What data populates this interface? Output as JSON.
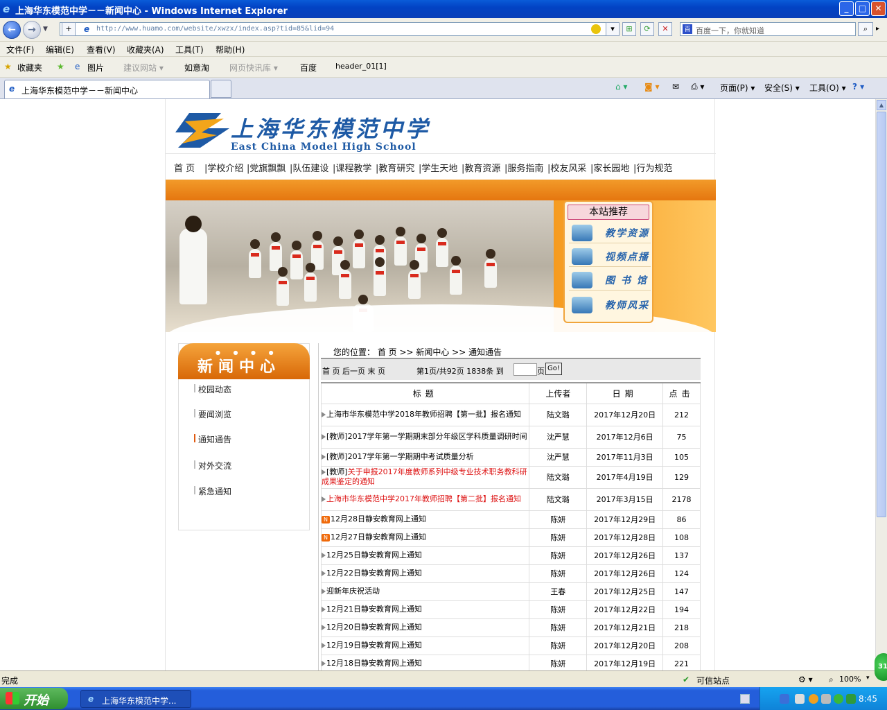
{
  "window": {
    "title": "上海华东模范中学－－新闻中心 - Windows Internet Explorer",
    "minimize": "_",
    "maximize": "□",
    "close": "✕"
  },
  "navbar": {
    "back": "←",
    "forward": "→",
    "url": "http://www.huamo.com/website/xwzx/index.asp?tid=85&lid=94",
    "search_placeholder": "百度一下，你就知道"
  },
  "menu": [
    "文件(F)",
    "编辑(E)",
    "查看(V)",
    "收藏夹(A)",
    "工具(T)",
    "帮助(H)"
  ],
  "favorites": {
    "fav_label": "收藏夹",
    "items": [
      "图片",
      "建议网站 ▾",
      "如意淘",
      "网页快讯库 ▾",
      "百度",
      "header_01[1]"
    ]
  },
  "tabs": {
    "active": "上海华东模范中学－－新闻中心",
    "tools": [
      "页面(P) ▾",
      "安全(S) ▾",
      "工具(O) ▾"
    ]
  },
  "site": {
    "logo_cn": "上海华东模范中学",
    "logo_en": "East China Model High School",
    "nav": [
      "首  页",
      "|学校介绍",
      "|党旗飘飘",
      "|队伍建设",
      "|课程教学",
      "|教育研究",
      "|学生天地",
      "|教育资源",
      "|服务指南",
      "|校友风采",
      "|家长园地",
      "|行为规范"
    ],
    "recommend_title": "本站推荐",
    "recommend": [
      "教学资源",
      "视频点播",
      "图 书 馆",
      "教师风采"
    ],
    "sidebar_title": "新闻中心",
    "sidebar_items": [
      "校园动态",
      "要闻浏览",
      "通知通告",
      "对外交流",
      "紧急通知"
    ],
    "breadcrumb": "您的位置：  首 页  >> 新闻中心  >> 通知通告",
    "pager": {
      "links": "首 页  后一页  末 页",
      "info": "第1页/共92页  1838条  到",
      "page_unit": "页",
      "go": "Go!"
    },
    "table_headers": [
      "标题",
      "上传者",
      "日期",
      "点击"
    ],
    "rows": [
      {
        "mark": "tri",
        "title": "上海市华东模范中学2018年教师招聘【第一批】报名通知",
        "uploader": "陆文璐",
        "date": "2017年12月20日",
        "hits": "212",
        "red": false
      },
      {
        "mark": "tri",
        "title": "[教师]2017学年第一学期期末部分年级区学科质量调研时间",
        "uploader": "沈严慧",
        "date": "2017年12月6日",
        "hits": "75",
        "red": false
      },
      {
        "mark": "tri",
        "title": "[教师]2017学年第一学期期中考试质量分析",
        "uploader": "沈严慧",
        "date": "2017年11月3日",
        "hits": "105",
        "red": false
      },
      {
        "mark": "tri",
        "prefix": "[教师]",
        "title": "关于申报2017年度教师系列中级专业技术职务教科研成果鉴定的通知",
        "uploader": "陆文璐",
        "date": "2017年4月19日",
        "hits": "129",
        "red": true
      },
      {
        "mark": "tri",
        "title": "上海市华东模范中学2017年教师招聘【第二批】报名通知",
        "uploader": "陆文璐",
        "date": "2017年3月15日",
        "hits": "2178",
        "red": true
      },
      {
        "mark": "new",
        "title": "12月28日静安教育网上通知",
        "uploader": "陈妍",
        "date": "2017年12月29日",
        "hits": "86",
        "red": false
      },
      {
        "mark": "new",
        "title": "12月27日静安教育网上通知",
        "uploader": "陈妍",
        "date": "2017年12月28日",
        "hits": "108",
        "red": false
      },
      {
        "mark": "tri",
        "title": "12月25日静安教育网上通知",
        "uploader": "陈妍",
        "date": "2017年12月26日",
        "hits": "137",
        "red": false
      },
      {
        "mark": "tri",
        "title": "12月22日静安教育网上通知",
        "uploader": "陈妍",
        "date": "2017年12月26日",
        "hits": "124",
        "red": false
      },
      {
        "mark": "tri",
        "title": "迎新年庆祝活动",
        "uploader": "王春",
        "date": "2017年12月25日",
        "hits": "147",
        "red": false
      },
      {
        "mark": "tri",
        "title": "12月21日静安教育网上通知",
        "uploader": "陈妍",
        "date": "2017年12月22日",
        "hits": "194",
        "red": false
      },
      {
        "mark": "tri",
        "title": "12月20日静安教育网上通知",
        "uploader": "陈妍",
        "date": "2017年12月21日",
        "hits": "218",
        "red": false
      },
      {
        "mark": "tri",
        "title": "12月19日静安教育网上通知",
        "uploader": "陈妍",
        "date": "2017年12月20日",
        "hits": "208",
        "red": false
      },
      {
        "mark": "tri",
        "title": "12月18日静安教育网上通知",
        "uploader": "陈妍",
        "date": "2017年12月19日",
        "hits": "221",
        "red": false
      }
    ]
  },
  "status": {
    "left": "完成",
    "zone": "可信站点",
    "zoom": "100%"
  },
  "taskbar": {
    "start": "开始",
    "item": "上海华东模范中学...",
    "clock": "8:45",
    "badge": "31"
  }
}
